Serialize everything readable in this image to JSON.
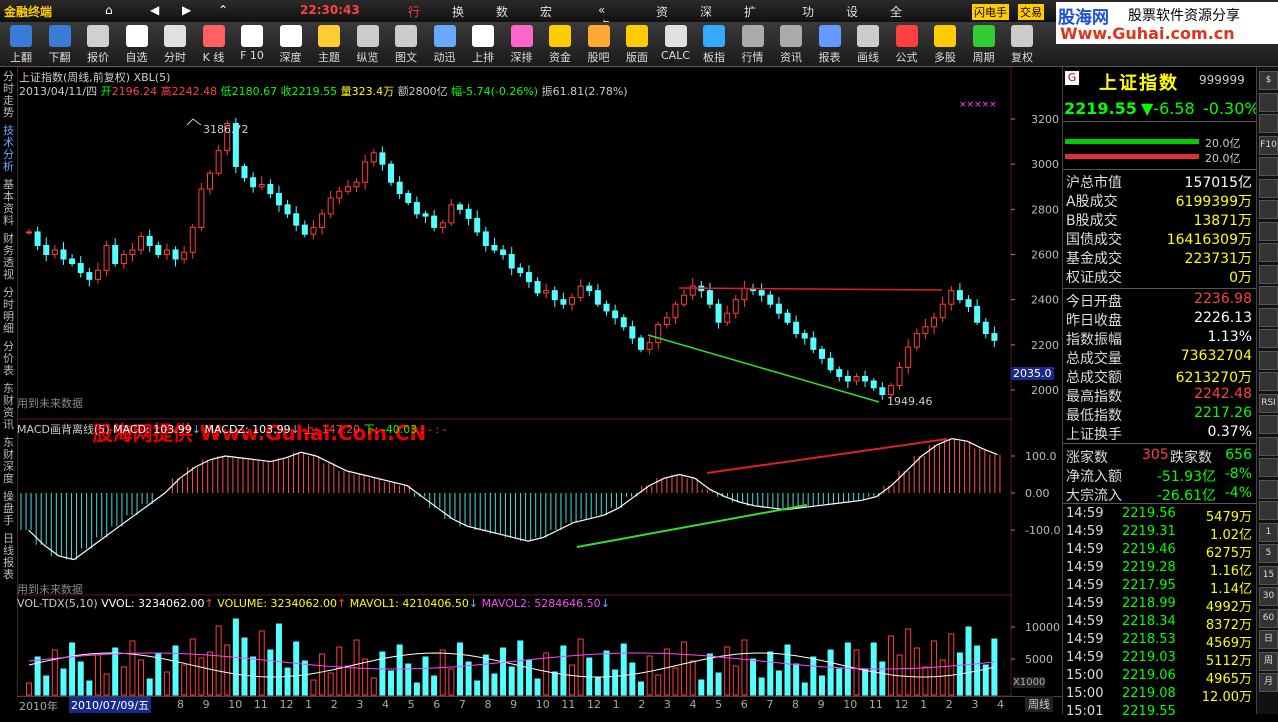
{
  "app": {
    "title": "金融终端",
    "time": "22:30:43",
    "menu": [
      "行情",
      "换盘",
      "数据",
      "宏观 »",
      "« 点金",
      "资讯",
      "深度",
      "扩展 »",
      "功能",
      "设置",
      "全菜单"
    ],
    "badges": [
      "闪电手",
      "交易"
    ]
  },
  "watermark": {
    "brand": "股海网",
    "tagline": "股票软件资源分享",
    "url": "Www.Guhai.com.cn",
    "center": "股海网提供 Www.Guhai.Com.CN"
  },
  "toolbar": [
    {
      "label": "上翻",
      "icon": "up-arrow-icon"
    },
    {
      "label": "下翻",
      "icon": "down-arrow-icon"
    },
    {
      "label": "报价",
      "icon": "quote-icon"
    },
    {
      "label": "自选",
      "icon": "f6-icon"
    },
    {
      "label": "分时",
      "icon": "intraday-icon"
    },
    {
      "label": "K 线",
      "icon": "kline-icon"
    },
    {
      "label": "F 10",
      "icon": "f10-icon"
    },
    {
      "label": "深度",
      "icon": "f9-icon"
    },
    {
      "label": "主题",
      "icon": "theme-icon"
    },
    {
      "label": "纵览",
      "icon": "overview-icon"
    },
    {
      "label": "图文",
      "icon": "graphic-icon"
    },
    {
      "label": "动迅",
      "icon": "news-icon"
    },
    {
      "label": "上排",
      "icon": "top-rank-icon"
    },
    {
      "label": "深排",
      "icon": "sz-rank-icon"
    },
    {
      "label": "资金",
      "icon": "fund-icon"
    },
    {
      "label": "股吧",
      "icon": "forum-icon"
    },
    {
      "label": "版面",
      "icon": "layout-icon"
    },
    {
      "label": "CALC",
      "icon": "calc-icon"
    },
    {
      "label": "板指",
      "icon": "sector-index-icon"
    },
    {
      "label": "行情",
      "icon": "market-icon"
    },
    {
      "label": "资讯",
      "icon": "info-icon"
    },
    {
      "label": "报表",
      "icon": "report-icon"
    },
    {
      "label": "画线",
      "icon": "draw-line-icon"
    },
    {
      "label": "公式",
      "icon": "formula-icon"
    },
    {
      "label": "多股",
      "icon": "multi-stock-icon"
    },
    {
      "label": "周期",
      "icon": "period-icon"
    },
    {
      "label": "复权",
      "icon": "adjust-icon"
    }
  ],
  "left_tabs": [
    "分时走势",
    "技术分析",
    "基本资料",
    "财务透视",
    "分时明细",
    "分价表",
    "东财资讯",
    "东财深度",
    "操盘手",
    "日线报表"
  ],
  "chart": {
    "title": "上证指数(周线,前复权) XBL(5)",
    "ohlc_line": {
      "date": "2013/04/11/四",
      "open_label": "开",
      "open": "2196.24",
      "high_label": "高",
      "high": "2242.48",
      "low_label": "低",
      "low": "2180.67",
      "close_label": "收",
      "close": "2219.55",
      "vol_label": "量",
      "vol": "323.4万",
      "amt_label": "额",
      "amt": "2800亿",
      "chg_label": "幅",
      "chg": "-5.74(-0.26%)",
      "amp_label": "振",
      "amp": "61.81(2.78%)"
    },
    "peak_label": "3186.72",
    "trough_label": "1949.46",
    "cursor_price": "2035.0",
    "future_note": "用到未来数据",
    "x_start": "2010年",
    "x_cursor": "2010/07/09/五",
    "x_months": [
      "8",
      "9",
      "10",
      "11",
      "12",
      "1",
      "2",
      "3",
      "4",
      "5",
      "6",
      "7",
      "8",
      "9",
      "10",
      "11",
      "12",
      "1",
      "2",
      "3",
      "4",
      "5",
      "6",
      "7",
      "8",
      "9",
      "10",
      "11",
      "12",
      "1",
      "2",
      "3",
      "4"
    ],
    "period_tab": "周线",
    "vol_unit": "X1000"
  },
  "macd": {
    "title": "MACD画背离线(5)",
    "macd_label": "MACD: 103.99",
    "macdz_label": "MACDZ: 103.99",
    "up_label": "上: 147.20",
    "down_label": "下: -40.03",
    "dashes": ": - : -"
  },
  "vol": {
    "title": "VOL-TDX(5,10)",
    "vvol": "VVOL: 3234062.00",
    "volume": "VOLUME: 3234062.00",
    "mavol1": "MAVOL1: 4210406.50",
    "mavol2": "MAVOL2: 5284646.50"
  },
  "chart_data": {
    "type": "candlestick",
    "period": "weekly",
    "price_axis": [
      3200,
      3000,
      2800,
      2600,
      2400,
      2200,
      2000
    ],
    "macd_axis": [
      "100.0",
      "0.00",
      "-100.0"
    ],
    "vol_axis": [
      "10000",
      "5000"
    ],
    "closes": [
      2700,
      2640,
      2600,
      2620,
      2580,
      2560,
      2520,
      2490,
      2530,
      2640,
      2560,
      2600,
      2620,
      2680,
      2640,
      2600,
      2620,
      2580,
      2610,
      2720,
      2890,
      2960,
      3060,
      3180,
      2990,
      2940,
      2900,
      2910,
      2870,
      2820,
      2780,
      2730,
      2690,
      2720,
      2780,
      2850,
      2880,
      2900,
      2920,
      3010,
      3050,
      3000,
      2920,
      2870,
      2830,
      2780,
      2770,
      2720,
      2740,
      2820,
      2800,
      2760,
      2700,
      2640,
      2620,
      2600,
      2540,
      2520,
      2480,
      2430,
      2440,
      2400,
      2380,
      2410,
      2460,
      2440,
      2380,
      2350,
      2320,
      2280,
      2230,
      2180,
      2210,
      2290,
      2320,
      2380,
      2420,
      2460,
      2440,
      2380,
      2300,
      2340,
      2400,
      2450,
      2440,
      2420,
      2380,
      2340,
      2300,
      2250,
      2230,
      2180,
      2140,
      2090,
      2060,
      2040,
      2060,
      2040,
      2010,
      1980,
      2020,
      2100,
      2190,
      2250,
      2280,
      2320,
      2380,
      2440,
      2400,
      2370,
      2300,
      2250,
      2220
    ],
    "macd_values": [
      -100,
      -140,
      -170,
      -180,
      -150,
      -120,
      -90,
      -60,
      -30,
      0,
      40,
      70,
      90,
      100,
      95,
      90,
      85,
      95,
      110,
      100,
      80,
      60,
      50,
      40,
      30,
      20,
      -10,
      -40,
      -70,
      -90,
      -100,
      -110,
      -120,
      -130,
      -120,
      -100,
      -80,
      -70,
      -60,
      -40,
      -10,
      20,
      40,
      50,
      40,
      10,
      -10,
      -25,
      -35,
      -40,
      -45,
      -40,
      -35,
      -30,
      -25,
      -20,
      -10,
      20,
      60,
      100,
      130,
      147,
      140,
      120,
      104
    ],
    "mavol1_note": "4210406.50",
    "mavol2_note": "5284646.50"
  },
  "quote": {
    "name": "上证指数",
    "code": "999999",
    "flag": "G",
    "price": "2219.55",
    "change": "▼-6.58",
    "pct": "-0.30%",
    "bar1": "20.0亿",
    "bar2": "20.0亿",
    "rows1": [
      {
        "k": "沪总市值",
        "v": "157015亿",
        "c": "#ffffff"
      },
      {
        "k": "A股成交",
        "v": "6199399万",
        "c": "#ffff00"
      },
      {
        "k": "B股成交",
        "v": "13871万",
        "c": "#ffff00"
      },
      {
        "k": "国债成交",
        "v": "16416309万",
        "c": "#ffff00"
      },
      {
        "k": "基金成交",
        "v": "223731万",
        "c": "#ffff00"
      },
      {
        "k": "权证成交",
        "v": "0万",
        "c": "#ffff00"
      }
    ],
    "rows2": [
      {
        "k": "今日开盘",
        "v": "2236.98",
        "c": "#ff4040"
      },
      {
        "k": "昨日收盘",
        "v": "2226.13",
        "c": "#ffffff"
      },
      {
        "k": "指数振幅",
        "v": "1.13%",
        "c": "#ffffff"
      },
      {
        "k": "总成交量",
        "v": "73632704",
        "c": "#ffff00"
      },
      {
        "k": "总成交额",
        "v": "6213270万",
        "c": "#ffff00"
      },
      {
        "k": "最高指数",
        "v": "2242.48",
        "c": "#ff4040"
      },
      {
        "k": "最低指数",
        "v": "2217.26",
        "c": "#00ff00"
      },
      {
        "k": "上证换手",
        "v": "0.37%",
        "c": "#ffffff"
      }
    ],
    "updown": {
      "up_label": "涨家数",
      "up": "305",
      "down_label": "跌家数",
      "down": "656"
    },
    "flows": [
      {
        "k": "净流入额",
        "v": "-51.93亿",
        "p": "-8%"
      },
      {
        "k": "大宗流入",
        "v": "-26.61亿",
        "p": "-4%"
      }
    ],
    "ticks": [
      {
        "t": "14:59",
        "p": "2219.56",
        "v": "5479万"
      },
      {
        "t": "14:59",
        "p": "2219.31",
        "v": "1.02亿"
      },
      {
        "t": "14:59",
        "p": "2219.46",
        "v": "6275万"
      },
      {
        "t": "14:59",
        "p": "2219.28",
        "v": "1.16亿"
      },
      {
        "t": "14:59",
        "p": "2217.95",
        "v": "1.14亿"
      },
      {
        "t": "14:59",
        "p": "2218.99",
        "v": "4992万"
      },
      {
        "t": "14:59",
        "p": "2218.34",
        "v": "8372万"
      },
      {
        "t": "14:59",
        "p": "2218.53",
        "v": "4569万"
      },
      {
        "t": "14:59",
        "p": "2219.03",
        "v": "5112万"
      },
      {
        "t": "15:00",
        "p": "2219.06",
        "v": "4965万"
      },
      {
        "t": "15:00",
        "p": "2219.08",
        "v": "12.00万"
      },
      {
        "t": "15:01",
        "p": "2219.55",
        "v": ""
      }
    ]
  },
  "right_buttons": [
    "$",
    "",
    "",
    "F10",
    "",
    "",
    "",
    "",
    "",
    "",
    "",
    "",
    "",
    "",
    "",
    "RSI",
    "",
    "",
    "",
    "",
    "",
    "1",
    "5",
    "15",
    "30",
    "60",
    "日",
    "周",
    "月"
  ]
}
